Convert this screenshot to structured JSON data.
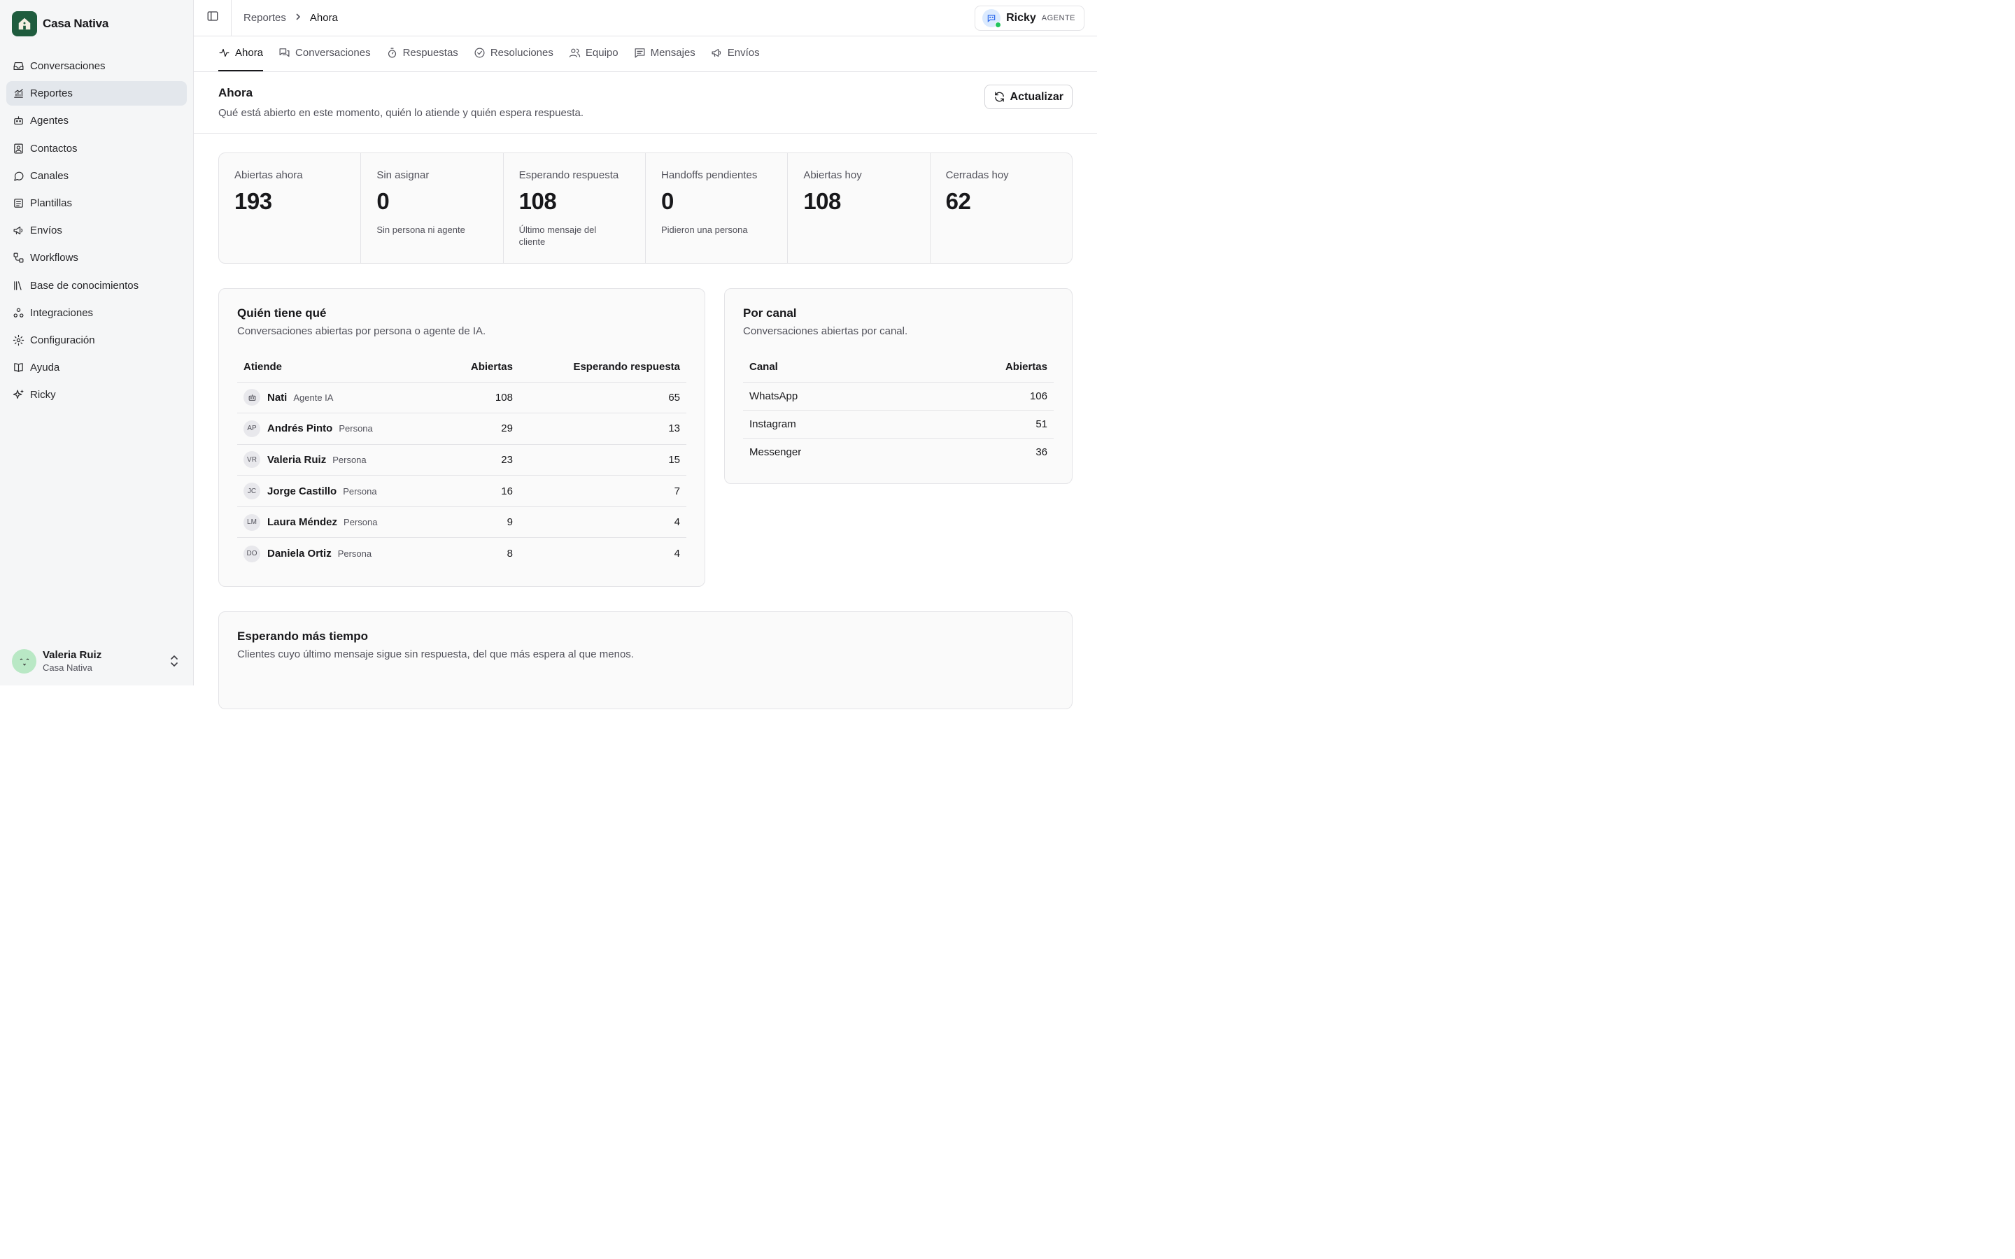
{
  "brand": {
    "name": "Casa Nativa"
  },
  "sidebar": {
    "items": [
      {
        "label": "Conversaciones",
        "icon": "inbox-icon"
      },
      {
        "label": "Reportes",
        "icon": "bar-chart-icon",
        "active": true
      },
      {
        "label": "Agentes",
        "icon": "bot-icon"
      },
      {
        "label": "Contactos",
        "icon": "contact-icon"
      },
      {
        "label": "Canales",
        "icon": "message-circle-icon"
      },
      {
        "label": "Plantillas",
        "icon": "template-icon"
      },
      {
        "label": "Envíos",
        "icon": "megaphone-icon"
      },
      {
        "label": "Workflows",
        "icon": "workflow-icon"
      },
      {
        "label": "Base de conocimientos",
        "icon": "library-icon"
      },
      {
        "label": "Integraciones",
        "icon": "integrations-icon"
      },
      {
        "label": "Configuración",
        "icon": "gear-icon"
      },
      {
        "label": "Ayuda",
        "icon": "book-icon"
      },
      {
        "label": "Ricky",
        "icon": "sparkles-icon"
      }
    ],
    "user": {
      "name": "Valeria Ruiz",
      "org": "Casa Nativa"
    }
  },
  "breadcrumb": {
    "root": "Reportes",
    "current": "Ahora"
  },
  "agent_chip": {
    "name": "Ricky",
    "role": "AGENTE",
    "status_color": "#22c55e"
  },
  "tabs": [
    {
      "label": "Ahora",
      "icon": "activity-icon",
      "active": true
    },
    {
      "label": "Conversaciones",
      "icon": "messages-icon"
    },
    {
      "label": "Respuestas",
      "icon": "timer-icon"
    },
    {
      "label": "Resoluciones",
      "icon": "check-circle-icon"
    },
    {
      "label": "Equipo",
      "icon": "users-icon"
    },
    {
      "label": "Mensajes",
      "icon": "message-square-icon"
    },
    {
      "label": "Envíos",
      "icon": "megaphone-icon"
    }
  ],
  "page": {
    "title": "Ahora",
    "subtitle": "Qué está abierto en este momento, quién lo atiende y quién espera respuesta.",
    "refresh_label": "Actualizar"
  },
  "stats": [
    {
      "label": "Abiertas ahora",
      "value": "193",
      "note": ""
    },
    {
      "label": "Sin asignar",
      "value": "0",
      "note": "Sin persona ni agente"
    },
    {
      "label": "Esperando respuesta",
      "value": "108",
      "note": "Último mensaje del cliente"
    },
    {
      "label": "Handoffs pendientes",
      "value": "0",
      "note": "Pidieron una persona"
    },
    {
      "label": "Abiertas hoy",
      "value": "108",
      "note": ""
    },
    {
      "label": "Cerradas hoy",
      "value": "62",
      "note": ""
    }
  ],
  "who": {
    "title": "Quién tiene qué",
    "subtitle": "Conversaciones abiertas por persona o agente de IA.",
    "headers": [
      "Atiende",
      "Abiertas",
      "Esperando respuesta"
    ],
    "rows": [
      {
        "initials": "",
        "name": "Nati",
        "kind": "Agente IA",
        "open": "108",
        "waiting": "65",
        "is_bot": true
      },
      {
        "initials": "AP",
        "name": "Andrés Pinto",
        "kind": "Persona",
        "open": "29",
        "waiting": "13"
      },
      {
        "initials": "VR",
        "name": "Valeria Ruiz",
        "kind": "Persona",
        "open": "23",
        "waiting": "15"
      },
      {
        "initials": "JC",
        "name": "Jorge Castillo",
        "kind": "Persona",
        "open": "16",
        "waiting": "7"
      },
      {
        "initials": "LM",
        "name": "Laura Méndez",
        "kind": "Persona",
        "open": "9",
        "waiting": "4"
      },
      {
        "initials": "DO",
        "name": "Daniela Ortiz",
        "kind": "Persona",
        "open": "8",
        "waiting": "4"
      }
    ]
  },
  "channel": {
    "title": "Por canal",
    "subtitle": "Conversaciones abiertas por canal.",
    "headers": [
      "Canal",
      "Abiertas"
    ],
    "rows": [
      {
        "name": "WhatsApp",
        "open": "106"
      },
      {
        "name": "Instagram",
        "open": "51"
      },
      {
        "name": "Messenger",
        "open": "36"
      }
    ]
  },
  "waiting": {
    "title": "Esperando más tiempo",
    "subtitle": "Clientes cuyo último mensaje sigue sin respuesta, del que más espera al que menos."
  },
  "colors": {
    "brand": "#1f5c3e",
    "active_nav": "#e3e7ec"
  }
}
